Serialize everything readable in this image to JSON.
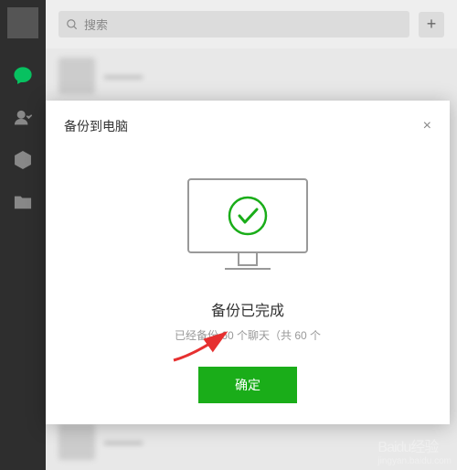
{
  "search": {
    "placeholder": "搜索"
  },
  "addBtn": "+",
  "modal": {
    "title": "备份到电脑",
    "close": "×",
    "completeTitle": "备份已完成",
    "completeSub": "已经备份 60 个聊天（共 60 个",
    "confirm": "确定"
  },
  "watermark": {
    "logo": "Baidu经验",
    "sub": "jingyan.baidu.com"
  }
}
